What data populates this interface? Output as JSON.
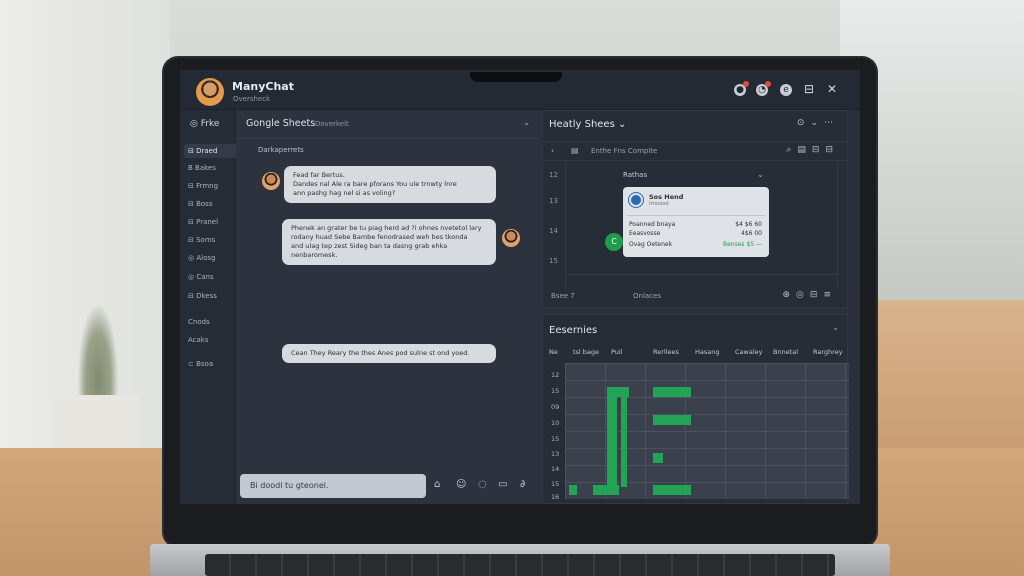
{
  "app": {
    "title": "ManyChat",
    "subtitle": "Oversheck"
  },
  "titlebar": {
    "icons": [
      "notification-icon",
      "chat-icon",
      "info-icon",
      "window-icon",
      "close-icon"
    ],
    "close_glyph": "✕"
  },
  "sidebar": {
    "header": "Frke",
    "items": [
      {
        "label": "Draed",
        "active": true
      },
      {
        "label": "Bakes"
      },
      {
        "label": "Frmng"
      },
      {
        "label": "Boss"
      },
      {
        "label": "Pranel"
      },
      {
        "label": "Soms"
      },
      {
        "label": "Alosg"
      },
      {
        "label": "Cans"
      },
      {
        "label": "Dkess"
      },
      {
        "label": "Cnods"
      },
      {
        "label": "Acaks"
      },
      {
        "label": "Bsoa"
      }
    ]
  },
  "chat": {
    "header": "Gongle Sheets",
    "header_sub": "Doverkelt",
    "thread_label": "Darkaperrets",
    "messages": [
      {
        "text": "Fead far Bertus.\nDandes nal Ale ra bare pforans You ule trnwty lnre\nann pashg hag nel si as voling?",
        "side": "left"
      },
      {
        "text": "Phenek an grater be tu piag herd ad ?i ohnes nvetetol lary\nrodany huad Sebe Bambe fenodrased weh bes tkonda\nand ulag tep zest Sideg ban ta dasng grab ehka\nnenbaromesk.",
        "side": "right"
      },
      {
        "text": "Cean They Reary the thes Anes pod sulne st ond yoed.",
        "side": "left"
      }
    ],
    "composer_placeholder": "Bi doodl tu gteonel."
  },
  "right_top": {
    "title": "Heatly Shees",
    "toolbar_text": "Enthe Fns Compite",
    "row_numbers": [
      "12",
      "13",
      "14",
      "15"
    ],
    "filter_label": "Rathas",
    "popup": {
      "name": "Sos Hend",
      "sub": "Imossd",
      "rows": [
        {
          "k": "Poanned bnaya",
          "v": "$4 $6 60"
        },
        {
          "k": "Eeasvosse",
          "v": "4$6 00"
        },
        {
          "k": "Ovag Oetenek",
          "v": "Benses $5 —"
        }
      ]
    },
    "footer_left": "Bsee  7",
    "footer_mid": "Onlaces",
    "accent": "#1f9c4c"
  },
  "right_bottom": {
    "title": "Eesernies",
    "columns": [
      "Ne",
      "tsl bage",
      "Puil",
      "Rerllees",
      "Hasang",
      "Cawaley",
      "Bnnetal",
      "Rarghrey"
    ],
    "rows": [
      "12",
      "15",
      "09",
      "10",
      "15",
      "13",
      "14",
      "15",
      "16"
    ],
    "cell_color": "#22a355"
  }
}
